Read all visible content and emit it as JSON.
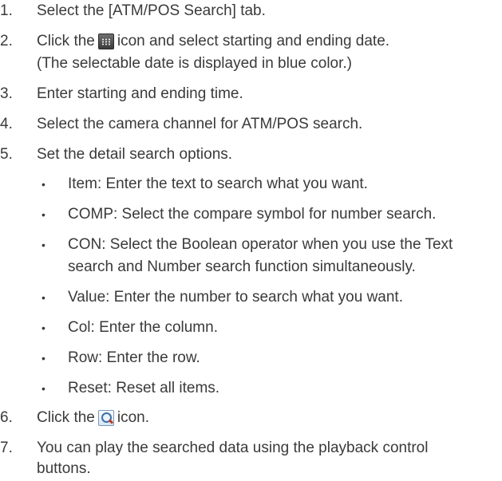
{
  "steps": [
    {
      "num": "1.",
      "text": "Select the [ATM/POS Search] tab."
    },
    {
      "num": "2.",
      "pre": "Click the",
      "icon": "calendar-icon",
      "post": "icon and select starting and ending date.",
      "cont": "(The selectable date is displayed in blue color.)"
    },
    {
      "num": "3.",
      "text": "Enter starting and ending time."
    },
    {
      "num": "4.",
      "text": "Select the camera channel for ATM/POS search."
    },
    {
      "num": "5.",
      "text": "Set the detail search options."
    },
    {
      "num": "6.",
      "pre": "Click the",
      "icon": "search-magnifier-icon",
      "post": "icon."
    },
    {
      "num": "7.",
      "text": "You can play the searched data using the playback control",
      "cont": "buttons."
    }
  ],
  "options": [
    {
      "bullet": "•",
      "text": "Item: Enter the text to search what you want."
    },
    {
      "bullet": "•",
      "text": "COMP: Select the compare symbol for number search."
    },
    {
      "bullet": "•",
      "text": "CON: Select the Boolean operator when you use the Text",
      "cont": "search and Number search function simultaneously."
    },
    {
      "bullet": "•",
      "text": "Value: Enter the number to search what you want."
    },
    {
      "bullet": "•",
      "text": "Col: Enter the column."
    },
    {
      "bullet": "•",
      "text": "Row: Enter the row."
    },
    {
      "bullet": "•",
      "text": "Reset: Reset all items."
    }
  ]
}
